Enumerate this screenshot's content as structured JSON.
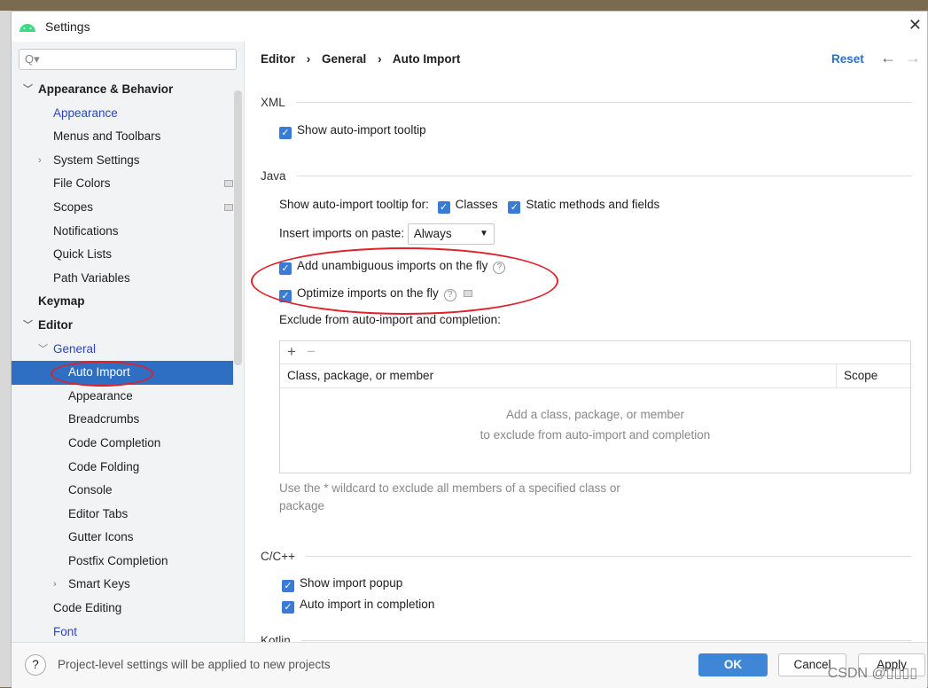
{
  "window": {
    "title": "Settings",
    "close": "✕"
  },
  "sidebar": {
    "search_placeholder": "Q▾",
    "items": [
      {
        "label": "Appearance & Behavior",
        "level": 0,
        "bold": true,
        "arrow": "﹀"
      },
      {
        "label": "Appearance",
        "level": 1,
        "blue": true
      },
      {
        "label": "Menus and Toolbars",
        "level": 1
      },
      {
        "label": "System Settings",
        "level": 1,
        "arrow": "›"
      },
      {
        "label": "File Colors",
        "level": 1,
        "project": true
      },
      {
        "label": "Scopes",
        "level": 1,
        "project": true
      },
      {
        "label": "Notifications",
        "level": 1
      },
      {
        "label": "Quick Lists",
        "level": 1
      },
      {
        "label": "Path Variables",
        "level": 1
      },
      {
        "label": "Keymap",
        "level": 0,
        "bold": true
      },
      {
        "label": "Editor",
        "level": 0,
        "bold": true,
        "arrow": "﹀"
      },
      {
        "label": "General",
        "level": 1,
        "blue": true,
        "arrow": "﹀"
      },
      {
        "label": "Auto Import",
        "level": 2,
        "selected": true
      },
      {
        "label": "Appearance",
        "level": 2
      },
      {
        "label": "Breadcrumbs",
        "level": 2
      },
      {
        "label": "Code Completion",
        "level": 2
      },
      {
        "label": "Code Folding",
        "level": 2
      },
      {
        "label": "Console",
        "level": 2
      },
      {
        "label": "Editor Tabs",
        "level": 2
      },
      {
        "label": "Gutter Icons",
        "level": 2
      },
      {
        "label": "Postfix Completion",
        "level": 2
      },
      {
        "label": "Smart Keys",
        "level": 2,
        "arrow": "›"
      },
      {
        "label": "Code Editing",
        "level": 1
      },
      {
        "label": "Font",
        "level": 1,
        "blue": true
      }
    ]
  },
  "header": {
    "breadcrumb": [
      "Editor",
      "General",
      "Auto Import"
    ],
    "sep": "›",
    "reset": "Reset",
    "back": "←",
    "forward": "→"
  },
  "xml": {
    "title": "XML",
    "show_tooltip": "Show auto-import tooltip"
  },
  "java": {
    "title": "Java",
    "tooltip_for": "Show auto-import tooltip for:",
    "classes": "Classes",
    "static": "Static methods and fields",
    "insert_label": "Insert imports on paste:",
    "insert_value": "Always",
    "unambiguous": "Add unambiguous imports on the fly",
    "optimize": "Optimize imports on the fly",
    "exclude_label": "Exclude from auto-import and completion:",
    "add": "+",
    "remove": "−",
    "col_class": "Class, package, or member",
    "col_scope": "Scope",
    "empty1": "Add a class, package, or member",
    "empty2": "to exclude from auto-import and completion",
    "hint1": "Use the * wildcard to exclude all members of a specified class or",
    "hint2": "package"
  },
  "cpp": {
    "title": "C/C++",
    "popup": "Show import popup",
    "completion": "Auto import in completion"
  },
  "kotlin": {
    "title": "Kotlin"
  },
  "footer": {
    "help": "?",
    "note": "Project-level settings will be applied to new projects",
    "ok": "OK",
    "cancel": "Cancel",
    "apply": "Apply"
  },
  "watermark": "CSDN @▯▯▯▯",
  "colors": {
    "accent": "#3a7bd5",
    "selected": "#2e6fc4",
    "annotation": "#e0202a"
  }
}
